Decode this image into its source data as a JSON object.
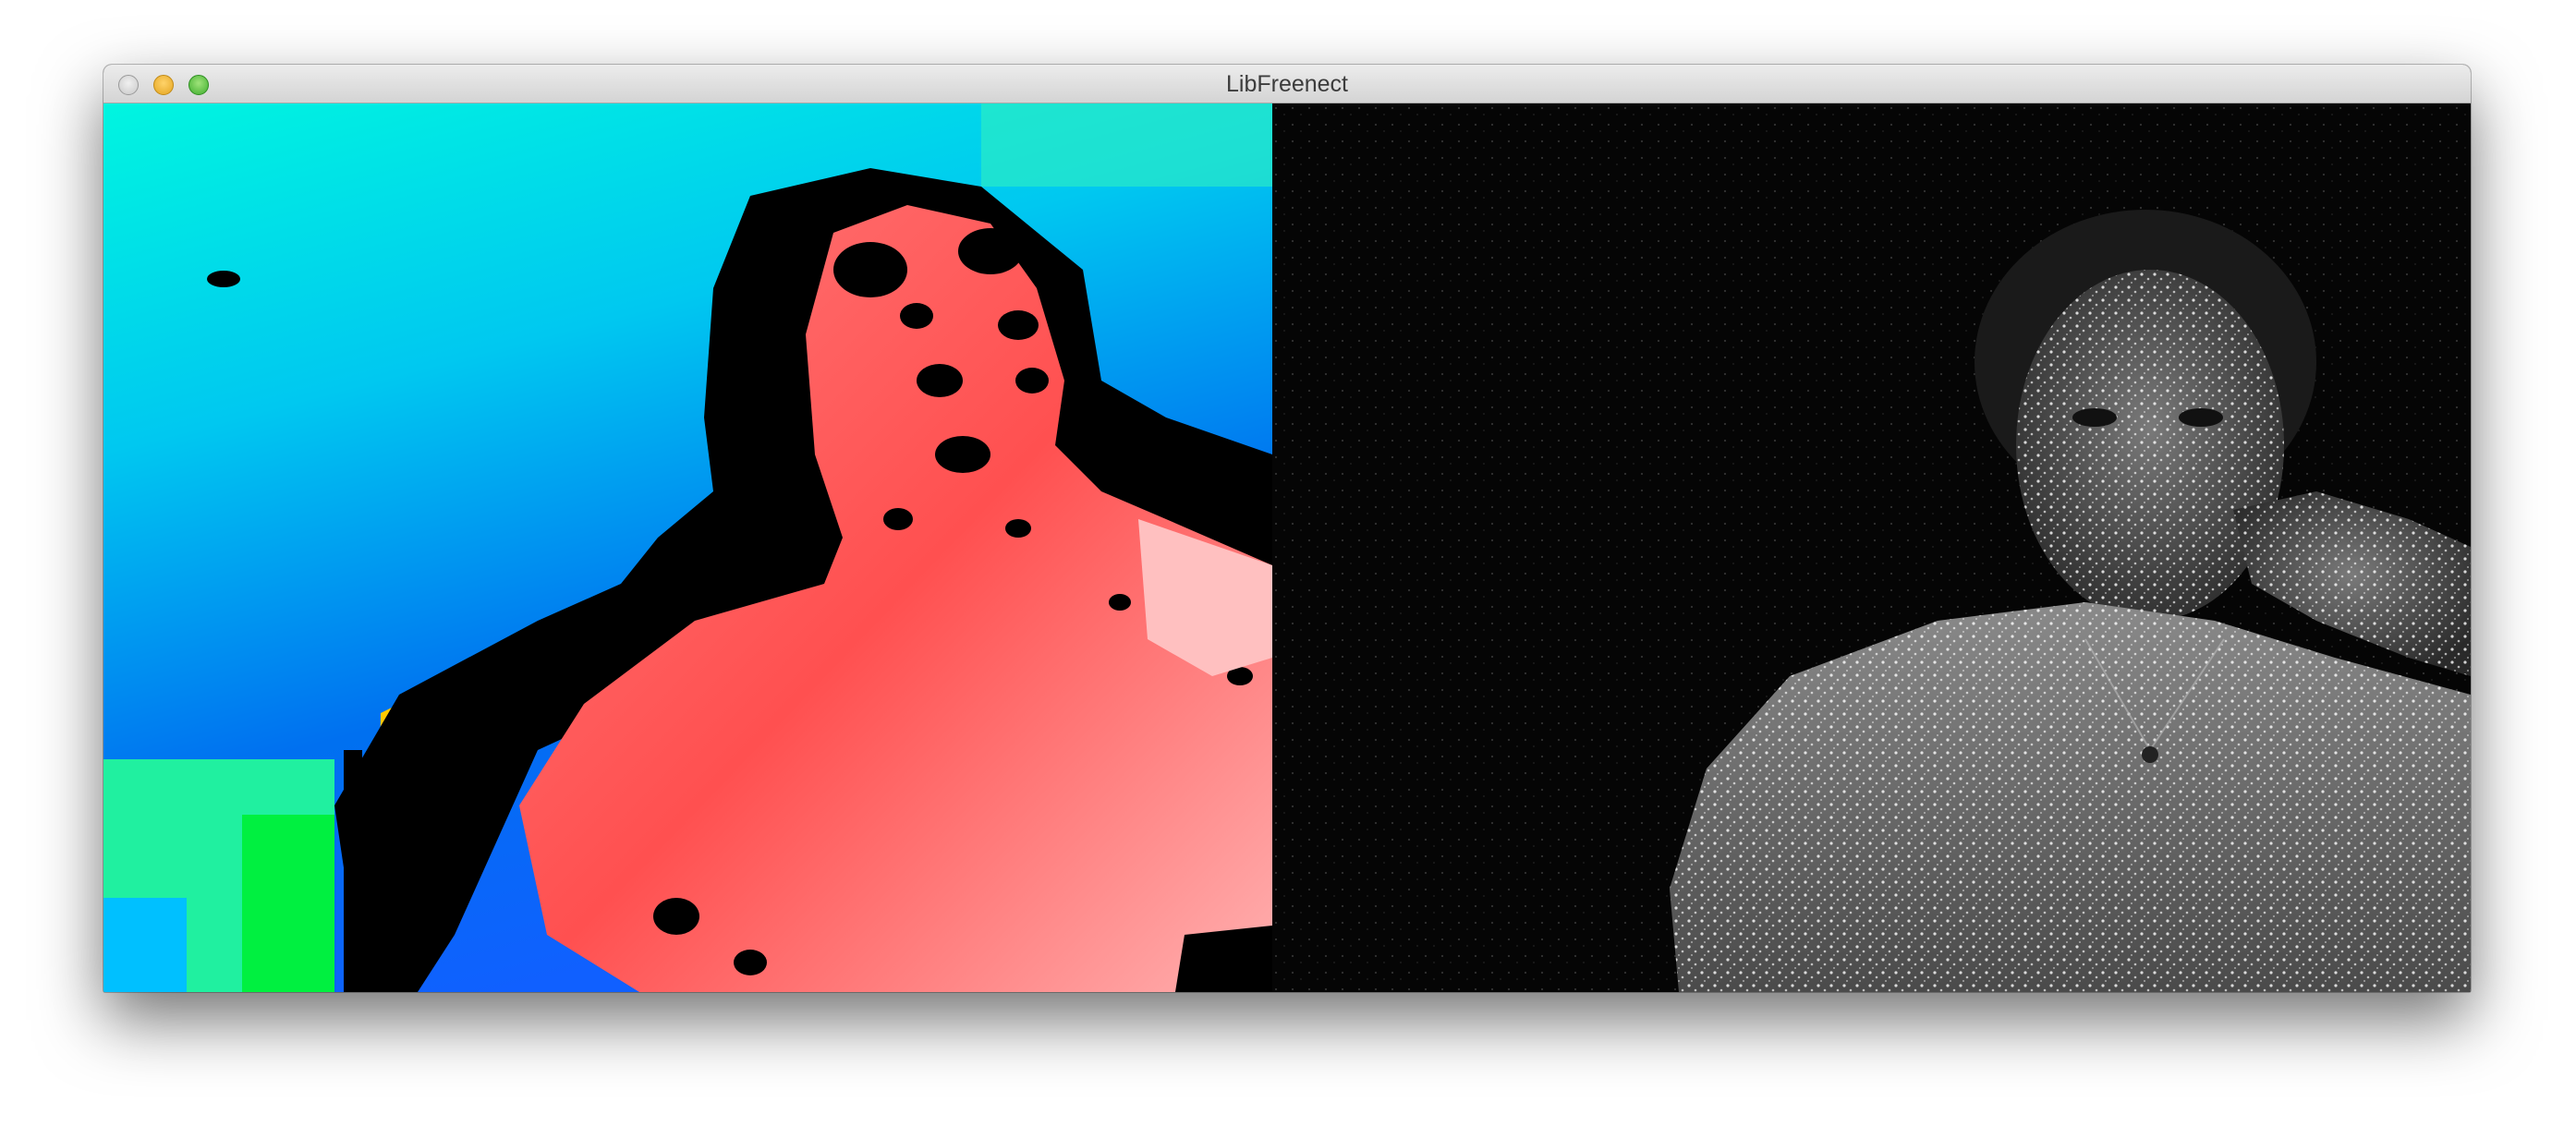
{
  "window": {
    "title": "LibFreenect"
  },
  "panels": {
    "depth": {
      "icon": "depth-image"
    },
    "ir": {
      "icon": "infrared-image"
    }
  },
  "colors": {
    "background_depth": "#00e5e0",
    "subject_depth": "#ff6a6a",
    "shadow": "#000000",
    "ir_background": "#050505"
  }
}
